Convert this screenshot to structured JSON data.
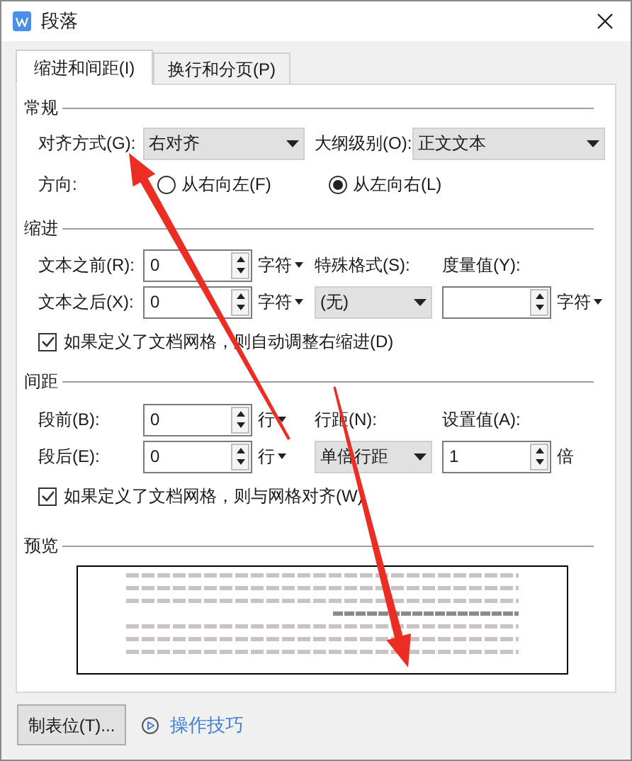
{
  "window": {
    "title": "段落"
  },
  "tabs": [
    {
      "label": "缩进和间距(I)",
      "selected": true
    },
    {
      "label": "换行和分页(P)",
      "selected": false
    }
  ],
  "general": {
    "heading": "常规",
    "alignment": {
      "label": "对齐方式(G):",
      "value": "右对齐"
    },
    "outline_level": {
      "label": "大纲级别(O):",
      "value": "正文文本"
    },
    "direction": {
      "label": "方向:",
      "options": [
        {
          "label": "从右向左(F)",
          "selected": false
        },
        {
          "label": "从左向右(L)",
          "selected": true
        }
      ]
    }
  },
  "indent": {
    "heading": "缩进",
    "before": {
      "label": "文本之前(R):",
      "value": "0",
      "unit": "字符"
    },
    "after": {
      "label": "文本之后(X):",
      "value": "0",
      "unit": "字符"
    },
    "special": {
      "label": "特殊格式(S):",
      "value": "(无)"
    },
    "measure": {
      "label": "度量值(Y):",
      "unit": "字符"
    },
    "checkbox": {
      "label": "如果定义了文档网格，则自动调整右缩进(D)",
      "checked": true
    }
  },
  "spacing": {
    "heading": "间距",
    "before": {
      "label": "段前(B):",
      "value": "0",
      "unit": "行"
    },
    "after": {
      "label": "段后(E):",
      "value": "0",
      "unit": "行"
    },
    "line_spacing": {
      "label": "行距(N):",
      "value": "单倍行距"
    },
    "set_value": {
      "label": "设置值(A):",
      "value": "1",
      "suffix": "倍"
    },
    "checkbox": {
      "label": "如果定义了文档网格，则与网格对齐(W)",
      "checked": true
    }
  },
  "preview": {
    "heading": "预览"
  },
  "footer": {
    "tabs_button": "制表位(T)...",
    "tips_link": "操作技巧"
  }
}
